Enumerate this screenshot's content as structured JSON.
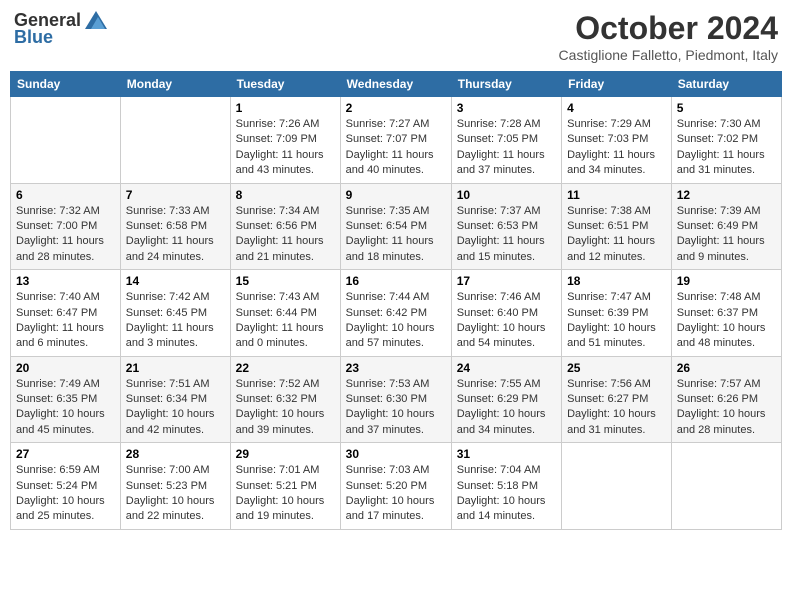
{
  "logo": {
    "general": "General",
    "blue": "Blue"
  },
  "title": "October 2024",
  "location": "Castiglione Falletto, Piedmont, Italy",
  "days_of_week": [
    "Sunday",
    "Monday",
    "Tuesday",
    "Wednesday",
    "Thursday",
    "Friday",
    "Saturday"
  ],
  "weeks": [
    [
      {
        "day": null,
        "sunrise": null,
        "sunset": null,
        "daylight": null
      },
      {
        "day": null,
        "sunrise": null,
        "sunset": null,
        "daylight": null
      },
      {
        "day": "1",
        "sunrise": "Sunrise: 7:26 AM",
        "sunset": "Sunset: 7:09 PM",
        "daylight": "Daylight: 11 hours and 43 minutes."
      },
      {
        "day": "2",
        "sunrise": "Sunrise: 7:27 AM",
        "sunset": "Sunset: 7:07 PM",
        "daylight": "Daylight: 11 hours and 40 minutes."
      },
      {
        "day": "3",
        "sunrise": "Sunrise: 7:28 AM",
        "sunset": "Sunset: 7:05 PM",
        "daylight": "Daylight: 11 hours and 37 minutes."
      },
      {
        "day": "4",
        "sunrise": "Sunrise: 7:29 AM",
        "sunset": "Sunset: 7:03 PM",
        "daylight": "Daylight: 11 hours and 34 minutes."
      },
      {
        "day": "5",
        "sunrise": "Sunrise: 7:30 AM",
        "sunset": "Sunset: 7:02 PM",
        "daylight": "Daylight: 11 hours and 31 minutes."
      }
    ],
    [
      {
        "day": "6",
        "sunrise": "Sunrise: 7:32 AM",
        "sunset": "Sunset: 7:00 PM",
        "daylight": "Daylight: 11 hours and 28 minutes."
      },
      {
        "day": "7",
        "sunrise": "Sunrise: 7:33 AM",
        "sunset": "Sunset: 6:58 PM",
        "daylight": "Daylight: 11 hours and 24 minutes."
      },
      {
        "day": "8",
        "sunrise": "Sunrise: 7:34 AM",
        "sunset": "Sunset: 6:56 PM",
        "daylight": "Daylight: 11 hours and 21 minutes."
      },
      {
        "day": "9",
        "sunrise": "Sunrise: 7:35 AM",
        "sunset": "Sunset: 6:54 PM",
        "daylight": "Daylight: 11 hours and 18 minutes."
      },
      {
        "day": "10",
        "sunrise": "Sunrise: 7:37 AM",
        "sunset": "Sunset: 6:53 PM",
        "daylight": "Daylight: 11 hours and 15 minutes."
      },
      {
        "day": "11",
        "sunrise": "Sunrise: 7:38 AM",
        "sunset": "Sunset: 6:51 PM",
        "daylight": "Daylight: 11 hours and 12 minutes."
      },
      {
        "day": "12",
        "sunrise": "Sunrise: 7:39 AM",
        "sunset": "Sunset: 6:49 PM",
        "daylight": "Daylight: 11 hours and 9 minutes."
      }
    ],
    [
      {
        "day": "13",
        "sunrise": "Sunrise: 7:40 AM",
        "sunset": "Sunset: 6:47 PM",
        "daylight": "Daylight: 11 hours and 6 minutes."
      },
      {
        "day": "14",
        "sunrise": "Sunrise: 7:42 AM",
        "sunset": "Sunset: 6:45 PM",
        "daylight": "Daylight: 11 hours and 3 minutes."
      },
      {
        "day": "15",
        "sunrise": "Sunrise: 7:43 AM",
        "sunset": "Sunset: 6:44 PM",
        "daylight": "Daylight: 11 hours and 0 minutes."
      },
      {
        "day": "16",
        "sunrise": "Sunrise: 7:44 AM",
        "sunset": "Sunset: 6:42 PM",
        "daylight": "Daylight: 10 hours and 57 minutes."
      },
      {
        "day": "17",
        "sunrise": "Sunrise: 7:46 AM",
        "sunset": "Sunset: 6:40 PM",
        "daylight": "Daylight: 10 hours and 54 minutes."
      },
      {
        "day": "18",
        "sunrise": "Sunrise: 7:47 AM",
        "sunset": "Sunset: 6:39 PM",
        "daylight": "Daylight: 10 hours and 51 minutes."
      },
      {
        "day": "19",
        "sunrise": "Sunrise: 7:48 AM",
        "sunset": "Sunset: 6:37 PM",
        "daylight": "Daylight: 10 hours and 48 minutes."
      }
    ],
    [
      {
        "day": "20",
        "sunrise": "Sunrise: 7:49 AM",
        "sunset": "Sunset: 6:35 PM",
        "daylight": "Daylight: 10 hours and 45 minutes."
      },
      {
        "day": "21",
        "sunrise": "Sunrise: 7:51 AM",
        "sunset": "Sunset: 6:34 PM",
        "daylight": "Daylight: 10 hours and 42 minutes."
      },
      {
        "day": "22",
        "sunrise": "Sunrise: 7:52 AM",
        "sunset": "Sunset: 6:32 PM",
        "daylight": "Daylight: 10 hours and 39 minutes."
      },
      {
        "day": "23",
        "sunrise": "Sunrise: 7:53 AM",
        "sunset": "Sunset: 6:30 PM",
        "daylight": "Daylight: 10 hours and 37 minutes."
      },
      {
        "day": "24",
        "sunrise": "Sunrise: 7:55 AM",
        "sunset": "Sunset: 6:29 PM",
        "daylight": "Daylight: 10 hours and 34 minutes."
      },
      {
        "day": "25",
        "sunrise": "Sunrise: 7:56 AM",
        "sunset": "Sunset: 6:27 PM",
        "daylight": "Daylight: 10 hours and 31 minutes."
      },
      {
        "day": "26",
        "sunrise": "Sunrise: 7:57 AM",
        "sunset": "Sunset: 6:26 PM",
        "daylight": "Daylight: 10 hours and 28 minutes."
      }
    ],
    [
      {
        "day": "27",
        "sunrise": "Sunrise: 6:59 AM",
        "sunset": "Sunset: 5:24 PM",
        "daylight": "Daylight: 10 hours and 25 minutes."
      },
      {
        "day": "28",
        "sunrise": "Sunrise: 7:00 AM",
        "sunset": "Sunset: 5:23 PM",
        "daylight": "Daylight: 10 hours and 22 minutes."
      },
      {
        "day": "29",
        "sunrise": "Sunrise: 7:01 AM",
        "sunset": "Sunset: 5:21 PM",
        "daylight": "Daylight: 10 hours and 19 minutes."
      },
      {
        "day": "30",
        "sunrise": "Sunrise: 7:03 AM",
        "sunset": "Sunset: 5:20 PM",
        "daylight": "Daylight: 10 hours and 17 minutes."
      },
      {
        "day": "31",
        "sunrise": "Sunrise: 7:04 AM",
        "sunset": "Sunset: 5:18 PM",
        "daylight": "Daylight: 10 hours and 14 minutes."
      },
      {
        "day": null,
        "sunrise": null,
        "sunset": null,
        "daylight": null
      },
      {
        "day": null,
        "sunrise": null,
        "sunset": null,
        "daylight": null
      }
    ]
  ]
}
